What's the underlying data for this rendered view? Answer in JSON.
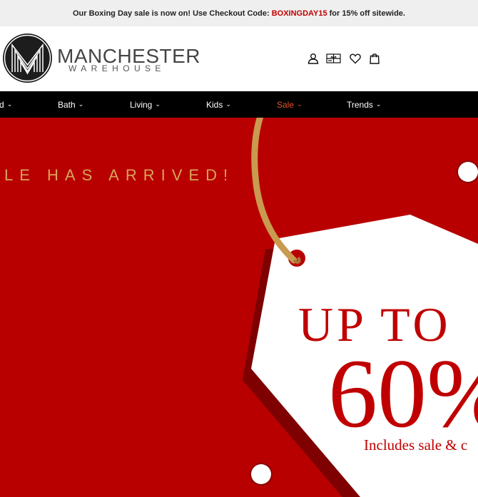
{
  "promo": {
    "prefix": "Our Boxing Day sale is now on! Use Checkout Code: ",
    "code": "BOXINGDAY15",
    "suffix": " for 15% off sitewide."
  },
  "logo": {
    "name": "MANCHESTER",
    "sub": "WAREHOUSE"
  },
  "header_icons": [
    "account-icon",
    "gift-card-icon",
    "wishlist-heart-icon",
    "shopping-bag-icon"
  ],
  "nav": {
    "items": [
      {
        "label": "d"
      },
      {
        "label": "Bath"
      },
      {
        "label": "Living"
      },
      {
        "label": "Kids"
      },
      {
        "label": "Sale"
      },
      {
        "label": "Trends"
      }
    ],
    "sale_color": "#e8542c"
  },
  "hero": {
    "headline": "LE HAS ARRIVED!",
    "tag_line1": "UP TO",
    "tag_line2": "60%",
    "tag_line3": "Includes sale & c",
    "colors": {
      "background": "#b80000",
      "headline": "#d9a45a",
      "tag": "#ffffff",
      "tag_text": "#c00000",
      "ribbon": "#c99a4f"
    }
  }
}
